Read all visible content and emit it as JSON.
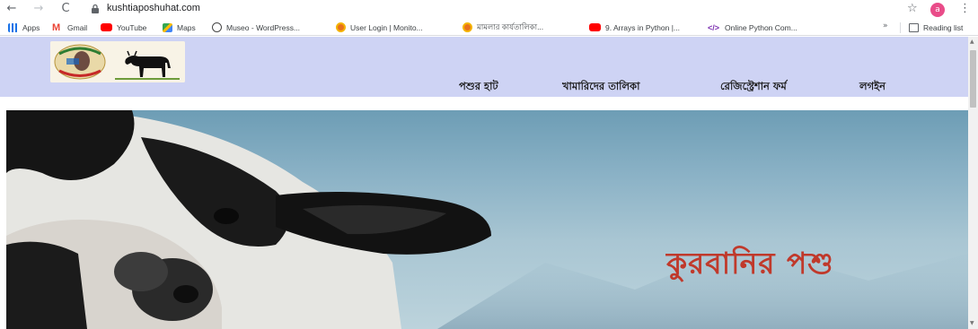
{
  "browser": {
    "url": "kushtiaposhuhat.com",
    "nav": {
      "back": "←",
      "forward": "→",
      "reload": "C"
    },
    "star": "☆",
    "profile_initial": "a",
    "menu": "⋮",
    "bookmarks": [
      {
        "label": "Apps",
        "icon": "apps-grid-icon",
        "color": "#1a73e8"
      },
      {
        "label": "Gmail",
        "icon": "gmail-icon",
        "color": "#ea4335"
      },
      {
        "label": "YouTube",
        "icon": "youtube-icon",
        "color": "#ff0000"
      },
      {
        "label": "Maps",
        "icon": "maps-icon",
        "color": "#34a853"
      },
      {
        "label": "Museo - WordPress...",
        "icon": "wordpress-icon",
        "color": "#464646"
      },
      {
        "label": "User Login | Monito...",
        "icon": "site-icon",
        "color": "#e8711c"
      },
      {
        "label": "মামলার কার্যতালিকা...",
        "icon": "site-icon",
        "color": "#e8711c"
      },
      {
        "label": "9. Arrays in Python |...",
        "icon": "youtube-icon",
        "color": "#ff0000"
      },
      {
        "label": "Online Python Com...",
        "icon": "code-icon",
        "color": "#7b2fb0"
      }
    ],
    "more_bookmarks": "»",
    "reading_list": "Reading list"
  },
  "site": {
    "nav_links": [
      "পশুর হাট",
      "খামারিদের তালিকা",
      "রেজিস্ট্রেশান ফর্ম",
      "লগইন"
    ],
    "hero_title": "কুরবানির পশু",
    "colors": {
      "navbar": "#ced3f4",
      "hero_title": "#c0392b"
    }
  }
}
